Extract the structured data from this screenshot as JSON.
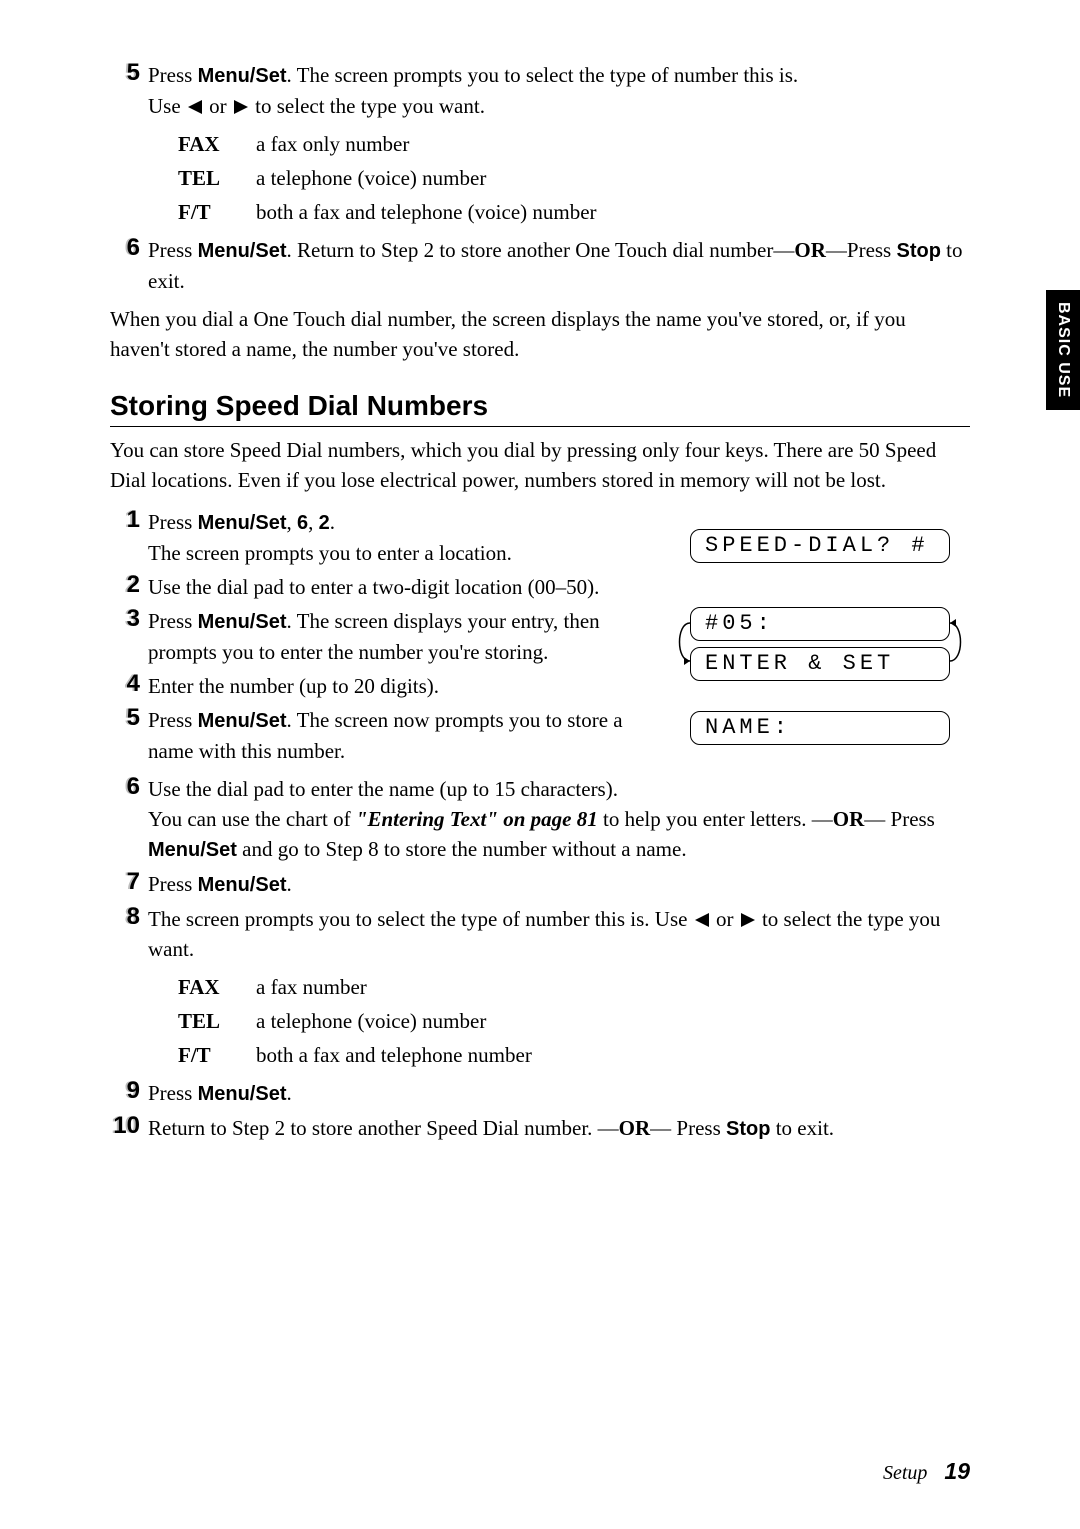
{
  "sideTab": "BASIC USE",
  "top": {
    "step5": {
      "n": "5",
      "line1a": "Press ",
      "line1b": "Menu/Set",
      "line1c": ". The screen prompts you to select the type of number this is.",
      "sub1a": "Use ",
      "sub1b": " or ",
      "sub1c": " to select the type you want.",
      "defs": [
        {
          "t": "FAX",
          "d": "a fax only number"
        },
        {
          "t": "TEL",
          "d": "a telephone (voice) number"
        },
        {
          "t": "F/T",
          "d": "both a fax and telephone (voice) number"
        }
      ]
    },
    "step6": {
      "n": "6",
      "a": "Press ",
      "b": "Menu/Set",
      "c": ". Return to Step 2 to store another One Touch dial number—",
      "d": "OR",
      "e": "—Press ",
      "f": "Stop",
      "g": " to exit."
    },
    "afterPara": "When you dial a One Touch dial number, the screen displays the name you've stored, or, if you haven't stored a name, the number you've stored."
  },
  "sectionTitle": "Storing Speed Dial Numbers",
  "sectionIntro": "You can store Speed Dial numbers, which you dial by pressing only four keys. There are 50 Speed Dial locations. Even if you lose electrical power, numbers stored in memory will not be lost.",
  "speed": {
    "s1": {
      "n": "1",
      "a": "Press ",
      "b": "Menu/Set",
      "c": ", ",
      "d": "6",
      "e": ", ",
      "f": "2",
      "g": ".",
      "sub": "The screen prompts you to enter a location."
    },
    "s2": {
      "n": "2",
      "t": "Use the dial pad to enter a two-digit location (00–50)."
    },
    "s3": {
      "n": "3",
      "a": "Press ",
      "b": "Menu/Set",
      "c": ". The screen displays your entry, then prompts you to enter the number you're storing."
    },
    "s4": {
      "n": "4",
      "t": "Enter the number (up to 20 digits)."
    },
    "s5": {
      "n": "5",
      "a": "Press ",
      "b": "Menu/Set",
      "c": ". The screen now prompts you to store a name with this number."
    },
    "s6": {
      "n": "6",
      "a": "Use the dial pad to enter the name (up to 15 characters).",
      "b": "You can use the chart of ",
      "ref": "\"Entering Text\" on page 81",
      "c": " to help you enter letters. —",
      "d": "OR",
      "e": "— Press ",
      "f": "Menu/Set",
      "g": " and go to Step 8 to store the number without a name."
    },
    "s7": {
      "n": "7",
      "a": "Press ",
      "b": "Menu/Set",
      "c": "."
    },
    "s8": {
      "n": "8",
      "a": "The screen prompts you to select the type of number this is. Use ",
      "b": " or ",
      "c": " to select the type you want.",
      "defs": [
        {
          "t": "FAX",
          "d": "a fax number"
        },
        {
          "t": "TEL",
          "d": "a telephone (voice) number"
        },
        {
          "t": "F/T",
          "d": "both a fax and telephone number"
        }
      ]
    },
    "s9": {
      "n": "9",
      "a": "Press ",
      "b": "Menu/Set",
      "c": "."
    },
    "s10": {
      "n": "10",
      "a": "Return to Step 2 to store another Speed Dial number. —",
      "b": "OR",
      "c": "— Press ",
      "d": "Stop",
      "e": " to exit."
    }
  },
  "lcd": {
    "l1": "SPEED-DIAL? #",
    "l2": "#05:",
    "l3": "ENTER & SET",
    "l4": "NAME:"
  },
  "footer": {
    "section": "Setup",
    "page": "19"
  }
}
